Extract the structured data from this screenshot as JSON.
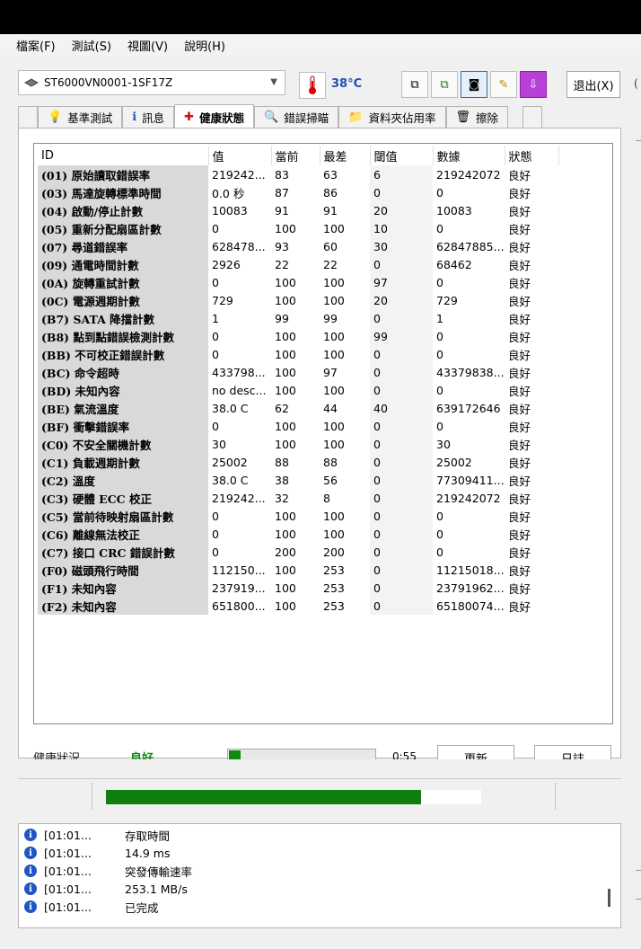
{
  "menu": [
    "檔案(F)",
    "測試(S)",
    "視圖(V)",
    "說明(H)"
  ],
  "drive": {
    "name": "ST6000VN0001-1SF17Z"
  },
  "temperature": "38°C",
  "exit_label": "退出(X)",
  "edge_label": "(",
  "tabs": [
    {
      "label": "基準測試",
      "icon": "lightbulb-icon",
      "glyph": "💡"
    },
    {
      "label": "訊息",
      "icon": "info-icon",
      "glyph": "ℹ"
    },
    {
      "label": "健康狀態",
      "icon": "red-cross-icon",
      "glyph": "✚",
      "active": true
    },
    {
      "label": "錯誤掃瞄",
      "icon": "magnifier-icon",
      "glyph": "🔍"
    },
    {
      "label": "資料夾佔用率",
      "icon": "folder-icon",
      "glyph": "📁"
    },
    {
      "label": "擦除",
      "icon": "trash-icon",
      "glyph": "🗑"
    }
  ],
  "table": {
    "headers": [
      "ID",
      "值",
      "當前",
      "最差",
      "閾值",
      "數據",
      "狀態"
    ],
    "rows": [
      [
        "(01) 原始讀取錯誤率",
        "219242...",
        "83",
        "63",
        "6",
        "219242072",
        "良好"
      ],
      [
        "(03) 馬達旋轉標準時間",
        "0.0 秒",
        "87",
        "86",
        "0",
        "0",
        "良好"
      ],
      [
        "(04) 啟動/停止計數",
        "10083",
        "91",
        "91",
        "20",
        "10083",
        "良好"
      ],
      [
        "(05) 重新分配扇區計數",
        "0",
        "100",
        "100",
        "10",
        "0",
        "良好"
      ],
      [
        "(07) 尋道錯誤率",
        "628478...",
        "93",
        "60",
        "30",
        "62847885...",
        "良好"
      ],
      [
        "(09) 通電時間計數",
        "2926",
        "22",
        "22",
        "0",
        "68462",
        "良好"
      ],
      [
        "(0A) 旋轉重試計數",
        "0",
        "100",
        "100",
        "97",
        "0",
        "良好"
      ],
      [
        "(0C) 電源週期計數",
        "729",
        "100",
        "100",
        "20",
        "729",
        "良好"
      ],
      [
        "(B7) SATA 降擋計數",
        "1",
        "99",
        "99",
        "0",
        "1",
        "良好"
      ],
      [
        "(B8) 點到點錯誤檢測計數",
        "0",
        "100",
        "100",
        "99",
        "0",
        "良好"
      ],
      [
        "(BB) 不可校正錯誤計數",
        "0",
        "100",
        "100",
        "0",
        "0",
        "良好"
      ],
      [
        "(BC) 命令超時",
        "433798...",
        "100",
        "97",
        "0",
        "43379838...",
        "良好"
      ],
      [
        "(BD) 未知內容",
        "no desc...",
        "100",
        "100",
        "0",
        "0",
        "良好"
      ],
      [
        "(BE) 氣流溫度",
        "38.0 C",
        "62",
        "44",
        "40",
        "639172646",
        "良好"
      ],
      [
        "(BF) 衝擊錯誤率",
        "0",
        "100",
        "100",
        "0",
        "0",
        "良好"
      ],
      [
        "(C0) 不安全關機計數",
        "30",
        "100",
        "100",
        "0",
        "30",
        "良好"
      ],
      [
        "(C1) 負載週期計數",
        "25002",
        "88",
        "88",
        "0",
        "25002",
        "良好"
      ],
      [
        "(C2) 溫度",
        "38.0 C",
        "38",
        "56",
        "0",
        "77309411...",
        "良好"
      ],
      [
        "(C3) 硬體 ECC 校正",
        "219242...",
        "32",
        "8",
        "0",
        "219242072",
        "良好"
      ],
      [
        "(C5) 當前待映射扇區計數",
        "0",
        "100",
        "100",
        "0",
        "0",
        "良好"
      ],
      [
        "(C6) 離線無法校正",
        "0",
        "100",
        "100",
        "0",
        "0",
        "良好"
      ],
      [
        "(C7) 接口 CRC 錯誤計數",
        "0",
        "200",
        "200",
        "0",
        "0",
        "良好"
      ],
      [
        "(F0) 磁頭飛行時間",
        "112150...",
        "100",
        "253",
        "0",
        "11215018...",
        "良好"
      ],
      [
        "(F1) 未知內容",
        "237919...",
        "100",
        "253",
        "0",
        "23791962...",
        "良好"
      ],
      [
        "(F2) 未知內容",
        "651800...",
        "100",
        "253",
        "0",
        "65180074...",
        "良好"
      ]
    ]
  },
  "health": {
    "label": "健康狀況",
    "value": "良好",
    "progress": 0.08,
    "time": "0:55",
    "refresh_label": "更新",
    "log_label": "日誌"
  },
  "status_progress": 0.84,
  "log": [
    {
      "time": "[01:01...",
      "msg": "存取時間"
    },
    {
      "time": "[01:01...",
      "msg": "14.9 ms"
    },
    {
      "time": "[01:01...",
      "msg": "突發傳輸速率"
    },
    {
      "time": "[01:01...",
      "msg": "253.1 MB/s"
    },
    {
      "time": "[01:01...",
      "msg": "已完成"
    }
  ]
}
